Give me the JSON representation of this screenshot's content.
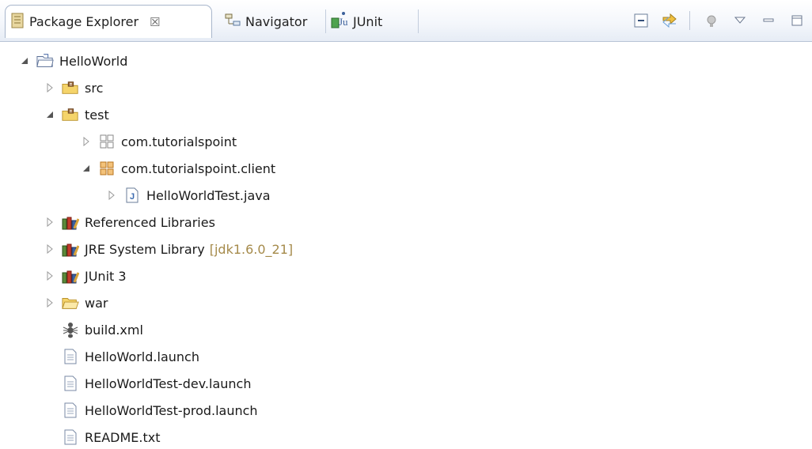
{
  "tabs": [
    {
      "label": "Package Explorer",
      "close": "☒",
      "active": true
    },
    {
      "label": "Navigator",
      "active": false
    },
    {
      "label": "JUnit",
      "active": false
    }
  ],
  "tree": [
    {
      "label": "HelloWorld",
      "icon": "project-icon",
      "expanded": true
    },
    {
      "label": "src",
      "icon": "source-folder-icon",
      "expanded": false
    },
    {
      "label": "test",
      "icon": "source-folder-icon",
      "expanded": true
    },
    {
      "label": "com.tutorialspoint",
      "icon": "empty-package-icon",
      "expanded": false
    },
    {
      "label": "com.tutorialspoint.client",
      "icon": "package-icon",
      "expanded": true
    },
    {
      "label": "HelloWorldTest.java",
      "icon": "java-file-icon",
      "expanded": false
    },
    {
      "label": "Referenced Libraries",
      "icon": "library-icon",
      "expanded": false
    },
    {
      "label": "JRE System Library",
      "decoration": "[jdk1.6.0_21]",
      "icon": "library-icon",
      "expanded": false
    },
    {
      "label": "JUnit 3",
      "icon": "library-icon",
      "expanded": false
    },
    {
      "label": "war",
      "icon": "folder-icon",
      "expanded": false
    },
    {
      "label": "build.xml",
      "icon": "ant-file-icon"
    },
    {
      "label": "HelloWorld.launch",
      "icon": "text-file-icon"
    },
    {
      "label": "HelloWorldTest-dev.launch",
      "icon": "text-file-icon"
    },
    {
      "label": "HelloWorldTest-prod.launch",
      "icon": "text-file-icon"
    },
    {
      "label": "README.txt",
      "icon": "text-file-icon"
    }
  ]
}
